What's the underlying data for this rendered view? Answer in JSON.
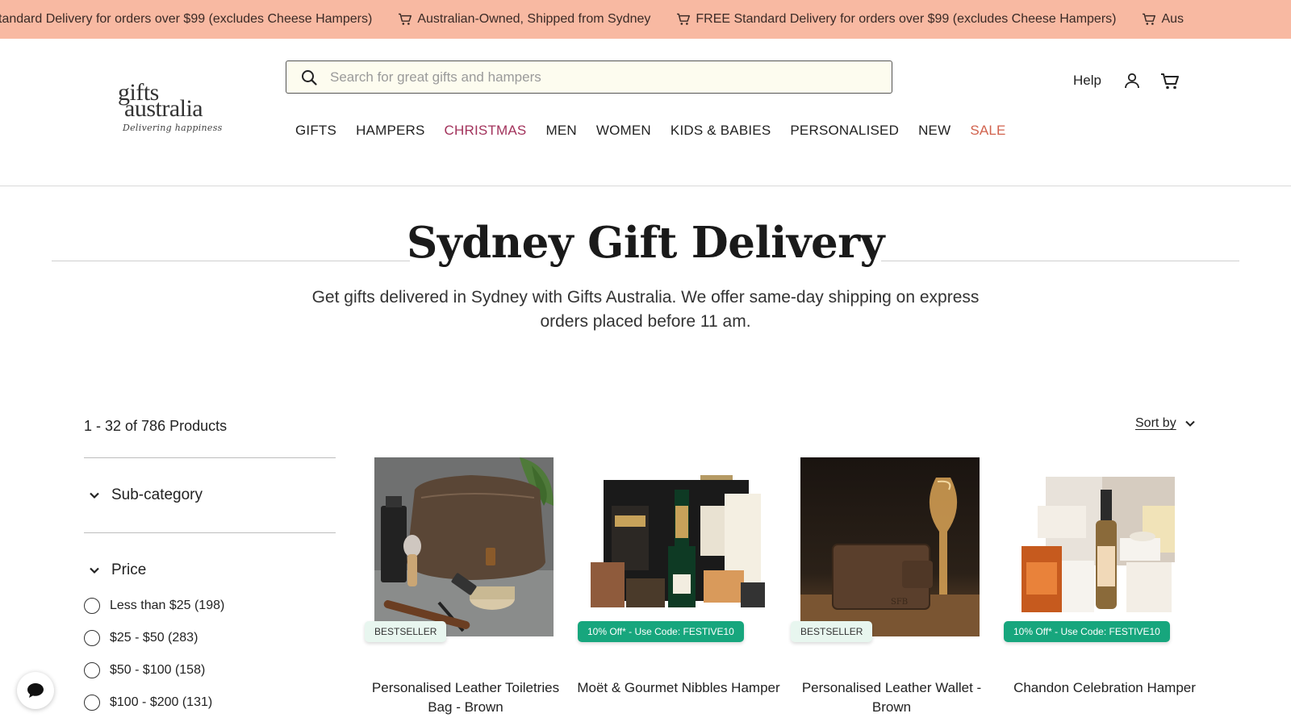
{
  "announcement": {
    "items": [
      "tandard Delivery for orders over $99 (excludes Cheese Hampers)",
      "Australian-Owned, Shipped from Sydney",
      "FREE Standard Delivery for orders over $99 (excludes Cheese Hampers)",
      "Aus"
    ],
    "background": "#f8b9a2"
  },
  "header": {
    "logo": {
      "line1": "gifts",
      "line2": "australia",
      "tagline": "Delivering happiness"
    },
    "search": {
      "placeholder": "Search for great gifts and hampers",
      "icon": "search-icon"
    },
    "help_label": "Help",
    "account_icon": "user-icon",
    "cart_icon": "cart-icon",
    "nav": [
      {
        "label": "GIFTS"
      },
      {
        "label": "HAMPERS"
      },
      {
        "label": "CHRISTMAS",
        "color": "#a2325b"
      },
      {
        "label": "MEN"
      },
      {
        "label": "WOMEN"
      },
      {
        "label": "KIDS & BABIES"
      },
      {
        "label": "PERSONALISED"
      },
      {
        "label": "NEW"
      },
      {
        "label": "SALE",
        "color": "#d1624d"
      }
    ]
  },
  "page": {
    "title": "Sydney Gift Delivery",
    "intro": "Get gifts delivered in Sydney with Gifts Australia. We offer same-day shipping on express orders placed before 11 am."
  },
  "listing": {
    "count": "1 - 32 of 786 Products",
    "sort_label": "Sort by"
  },
  "filters": {
    "subcategory": {
      "label": "Sub-category"
    },
    "price": {
      "label": "Price",
      "options": [
        "Less than $25 (198)",
        "$25 - $50 (283)",
        "$50 - $100 (158)",
        "$100 - $200 (131)"
      ]
    }
  },
  "products": [
    {
      "name": "Personalised Leather Toiletries Bag - Brown",
      "badge": "BESTSELLER",
      "badge_type": "best"
    },
    {
      "name": "Moët & Gourmet Nibbles Hamper",
      "badge": "10% Off* - Use Code: FESTIVE10",
      "badge_type": "promo"
    },
    {
      "name": "Personalised Leather Wallet - Brown",
      "badge": "BESTSELLER",
      "badge_type": "best"
    },
    {
      "name": "Chandon Celebration Hamper",
      "badge": "10% Off* - Use Code: FESTIVE10",
      "badge_type": "promo"
    }
  ],
  "colors": {
    "promo_badge": "#17a67d",
    "bestseller_badge": "#e8f6ef",
    "christmas": "#a2325b",
    "sale": "#d1624d"
  },
  "chat": {
    "icon": "chat-bubble-icon"
  }
}
